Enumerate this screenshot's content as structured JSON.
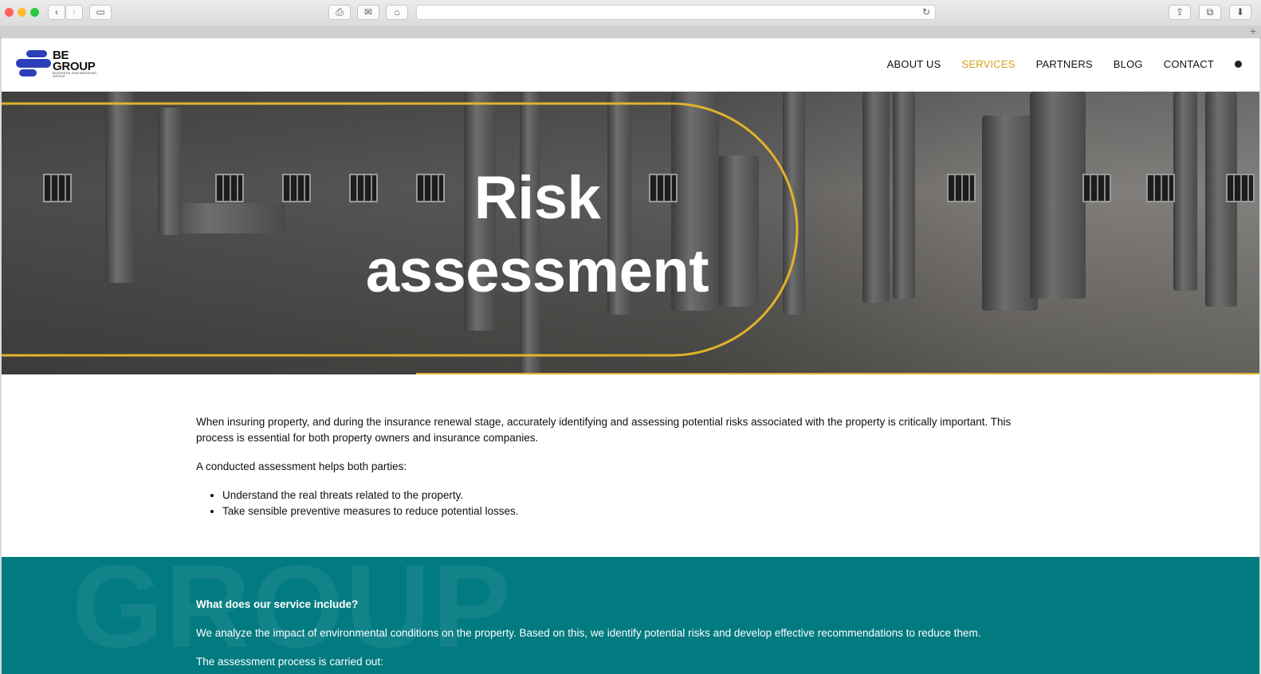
{
  "browser": {
    "colors": {
      "close": "#fe5f57",
      "minimize": "#febc2e",
      "maximize": "#28c840"
    }
  },
  "header": {
    "logo": {
      "line1": "BE",
      "line2": "GROUP",
      "tagline": "BUSINESS ENGINEERING GROUP",
      "color": "#2d3fb8"
    },
    "nav": [
      {
        "label": "ABOUT US",
        "active": false
      },
      {
        "label": "SERVICES",
        "active": true
      },
      {
        "label": "PARTNERS",
        "active": false
      },
      {
        "label": "BLOG",
        "active": false
      },
      {
        "label": "CONTACT",
        "active": false
      }
    ],
    "accent_color": "#d4a017"
  },
  "hero": {
    "title_line1": "Risk",
    "title_line2": "assessment",
    "frame_color": "#e0b42a"
  },
  "intro": {
    "paragraph1": "When insuring property, and during the insurance renewal stage, accurately identifying and assessing potential risks associated with the property is critically important. This process is essential for both property owners and insurance companies.",
    "paragraph2": "A conducted assessment helps both parties:",
    "bullets": [
      "Understand the real threats related to the property.",
      "Take sensible preventive measures to reduce potential losses."
    ]
  },
  "service": {
    "watermark": "GROUP",
    "heading": "What does our service include?",
    "paragraph": "We analyze the impact of environmental conditions on the property. Based on this, we identify potential risks and develop effective recommendations to reduce them.",
    "paragraph2": "The assessment process is carried out:",
    "bg_color": "#017a80"
  }
}
